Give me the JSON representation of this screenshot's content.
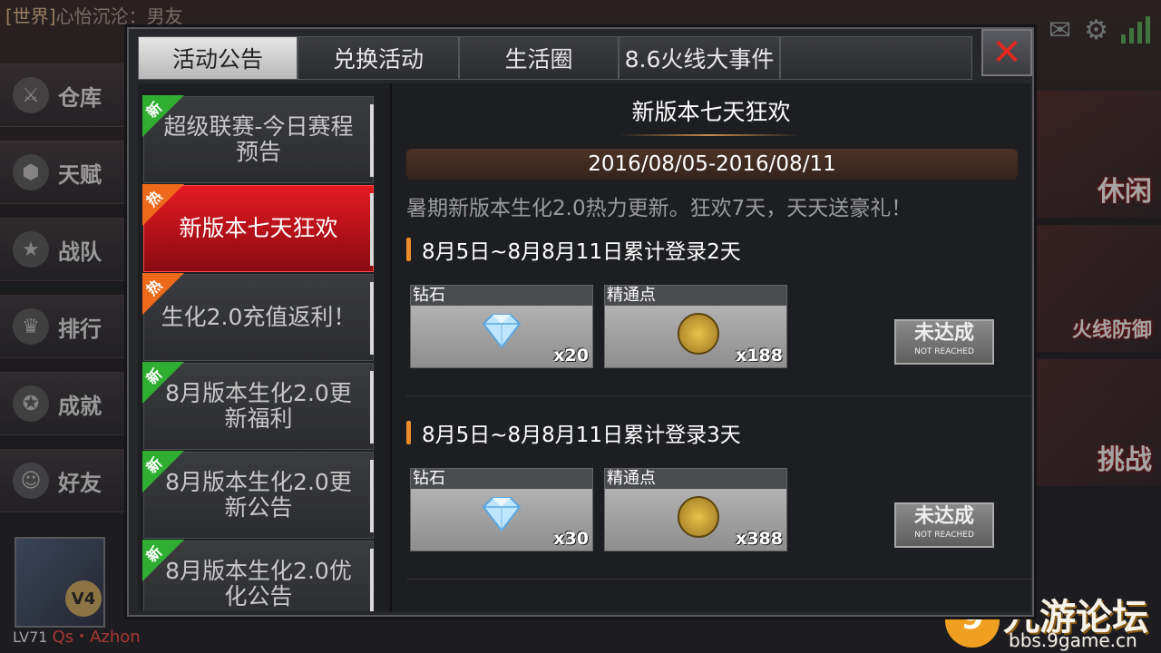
{
  "background": {
    "chat": {
      "tag": "[世界]",
      "text": "心怡沉沦：男友"
    },
    "left_menu": [
      {
        "label": "仓库",
        "icon": "warehouse-icon"
      },
      {
        "label": "天赋",
        "icon": "talent-icon"
      },
      {
        "label": "战队",
        "icon": "team-icon"
      },
      {
        "label": "排行",
        "icon": "trophy-icon"
      },
      {
        "label": "成就",
        "icon": "medal-icon"
      },
      {
        "label": "好友",
        "icon": "friends-icon"
      }
    ],
    "player": {
      "level": "LV71",
      "name": "Qs・Azhon",
      "vip": "V4"
    },
    "right_panels": [
      "休闲",
      "火线防御",
      "挑战"
    ],
    "watermark": {
      "name": "九游论坛",
      "url": "bbs.9game.cn"
    }
  },
  "dialog": {
    "tabs": [
      {
        "label": "活动公告",
        "active": true
      },
      {
        "label": "兑换活动",
        "active": false
      },
      {
        "label": "生活圈",
        "active": false
      },
      {
        "label": "8.6火线大事件",
        "active": false
      }
    ],
    "close_icon": "close-icon",
    "list": [
      {
        "badge": "新",
        "badge_type": "new",
        "text": "超级联赛-今日赛程预告",
        "active": false
      },
      {
        "badge": "热",
        "badge_type": "hot",
        "text": "新版本七天狂欢",
        "active": true
      },
      {
        "badge": "热",
        "badge_type": "hot",
        "text": "生化2.0充值返利！",
        "active": false
      },
      {
        "badge": "新",
        "badge_type": "new",
        "text": "8月版本生化2.0更新福利",
        "active": false
      },
      {
        "badge": "新",
        "badge_type": "new",
        "text": "8月版本生化2.0更新公告",
        "active": false
      },
      {
        "badge": "新",
        "badge_type": "new",
        "text": "8月版本生化2.0优化公告",
        "active": false
      }
    ],
    "content": {
      "title": "新版本七天狂欢",
      "date_range": "2016/08/05-2016/08/11",
      "description": "暑期新版本生化2.0热力更新。狂欢7天，天天送豪礼！",
      "rewards": [
        {
          "condition": "8月5日~8月8月11日累计登录2天",
          "items": [
            {
              "name": "钻石",
              "qty": "x20",
              "icon": "diamond-icon"
            },
            {
              "name": "精通点",
              "qty": "x188",
              "icon": "mastery-point-icon"
            }
          ],
          "status_cn": "未达成",
          "status_en": "NOT REACHED"
        },
        {
          "condition": "8月5日~8月8月11日累计登录3天",
          "items": [
            {
              "name": "钻石",
              "qty": "x30",
              "icon": "diamond-icon"
            },
            {
              "name": "精通点",
              "qty": "x388",
              "icon": "mastery-point-icon"
            }
          ],
          "status_cn": "未达成",
          "status_en": "NOT REACHED"
        }
      ]
    }
  },
  "colors": {
    "accent_red": "#e51a22",
    "new_badge": "#2fae32",
    "hot_badge": "#ee6a1a",
    "bar_orange": "#ef8a2a"
  }
}
